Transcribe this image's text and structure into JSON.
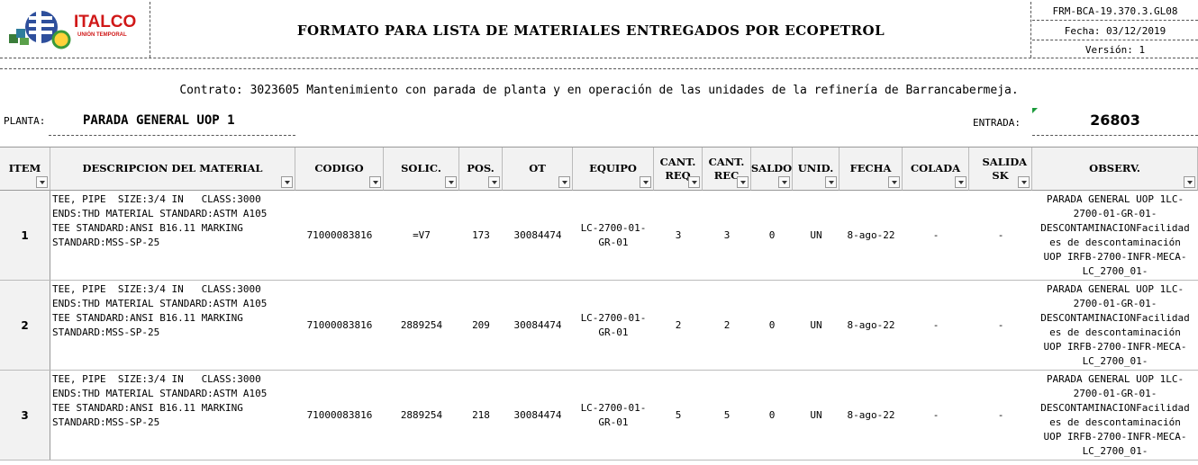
{
  "header": {
    "logo_text": "ITALCO",
    "logo_subtitle": "UNIÓN TEMPORAL",
    "title": "FORMATO PARA LISTA DE MATERIALES ENTREGADOS POR ECOPETROL",
    "doc_code": "FRM-BCA-19.370.3.GL08",
    "date": "Fecha: 03/12/2019",
    "version": "Versión: 1"
  },
  "contract": "Contrato: 3023605 Mantenimiento con parada de planta y en operación de las unidades de la refinería de Barrancabermeja.",
  "planta": {
    "label": "PLANTA:",
    "value": "PARADA GENERAL UOP 1"
  },
  "entrada": {
    "label": "ENTRADA:",
    "value": "26803"
  },
  "columns": [
    {
      "key": "item",
      "label": "ITEM"
    },
    {
      "key": "descripcion",
      "label": "DESCRIPCION DEL MATERIAL"
    },
    {
      "key": "codigo",
      "label": "CODIGO"
    },
    {
      "key": "solic",
      "label": "SOLIC."
    },
    {
      "key": "pos",
      "label": "POS."
    },
    {
      "key": "ot",
      "label": "OT"
    },
    {
      "key": "equipo",
      "label": "EQUIPO"
    },
    {
      "key": "cant_req",
      "label": "CANT. REQ"
    },
    {
      "key": "cant_rec",
      "label": "CANT. REC"
    },
    {
      "key": "saldo",
      "label": "SALDO"
    },
    {
      "key": "unid",
      "label": "UNID."
    },
    {
      "key": "fecha",
      "label": "FECHA"
    },
    {
      "key": "colada",
      "label": "COLADA"
    },
    {
      "key": "salida_sk",
      "label": "SALIDA SK"
    },
    {
      "key": "observ",
      "label": "OBSERV."
    }
  ],
  "rows": [
    {
      "item": "1",
      "descripcion": "TEE, PIPE  SIZE:3/4 IN   CLASS:3000\nENDS:THD MATERIAL STANDARD:ASTM A105\nTEE STANDARD:ANSI B16.11 MARKING\nSTANDARD:MSS-SP-25",
      "codigo": "71000083816",
      "solic": "=V7",
      "pos": "173",
      "ot": "30084474",
      "equipo": "LC-2700-01-\nGR-01",
      "cant_req": "3",
      "cant_rec": "3",
      "saldo": "0",
      "unid": "UN",
      "fecha": "8-ago-22",
      "colada": "-",
      "salida_sk": "-",
      "observ": "PARADA GENERAL UOP 1LC-\n2700-01-GR-01-\nDESCONTAMINACIONFacilidad\nes de descontaminación\nUOP IRFB-2700-INFR-MECA-\nLC_2700_01-"
    },
    {
      "item": "2",
      "descripcion": "TEE, PIPE  SIZE:3/4 IN   CLASS:3000\nENDS:THD MATERIAL STANDARD:ASTM A105\nTEE STANDARD:ANSI B16.11 MARKING\nSTANDARD:MSS-SP-25",
      "codigo": "71000083816",
      "solic": "2889254",
      "pos": "209",
      "ot": "30084474",
      "equipo": "LC-2700-01-\nGR-01",
      "cant_req": "2",
      "cant_rec": "2",
      "saldo": "0",
      "unid": "UN",
      "fecha": "8-ago-22",
      "colada": "-",
      "salida_sk": "-",
      "observ": "PARADA GENERAL UOP 1LC-\n2700-01-GR-01-\nDESCONTAMINACIONFacilidad\nes de descontaminación\nUOP IRFB-2700-INFR-MECA-\nLC_2700_01-"
    },
    {
      "item": "3",
      "descripcion": "TEE, PIPE  SIZE:3/4 IN   CLASS:3000\nENDS:THD MATERIAL STANDARD:ASTM A105\nTEE STANDARD:ANSI B16.11 MARKING\nSTANDARD:MSS-SP-25",
      "codigo": "71000083816",
      "solic": "2889254",
      "pos": "218",
      "ot": "30084474",
      "equipo": "LC-2700-01-\nGR-01",
      "cant_req": "5",
      "cant_rec": "5",
      "saldo": "0",
      "unid": "UN",
      "fecha": "8-ago-22",
      "colada": "-",
      "salida_sk": "-",
      "observ": "PARADA GENERAL UOP 1LC-\n2700-01-GR-01-\nDESCONTAMINACIONFacilidad\nes de descontaminación\nUOP IRFB-2700-INFR-MECA-\nLC_2700_01-"
    }
  ]
}
